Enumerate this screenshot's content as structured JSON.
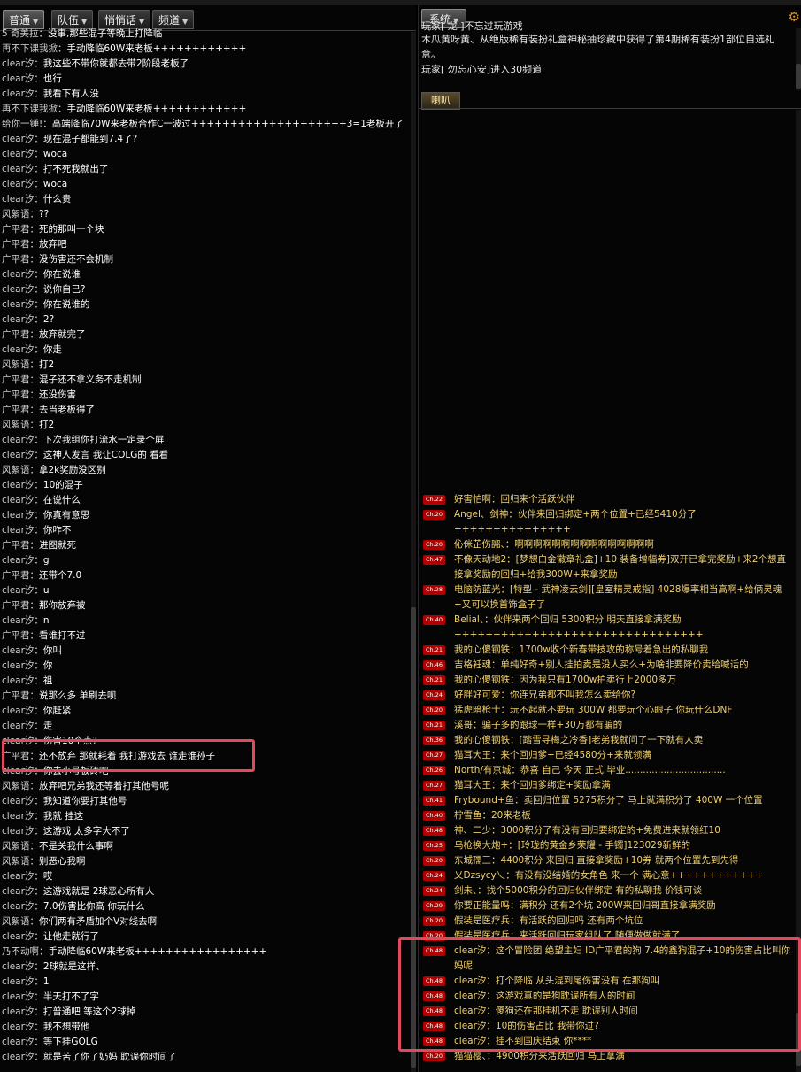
{
  "left_tabs": [
    "普通",
    "队伍",
    "悄悄话",
    "频道"
  ],
  "left_chat": [
    {
      "n": "5  奇美拉",
      "m": "没事,那些混子等晚上打降临"
    },
    {
      "n": "再不下课我掀",
      "m": "手动降临60W来老板++++++++++++"
    },
    {
      "n": "clear汐",
      "m": "我这些不带你就都去带2阶段老板了"
    },
    {
      "n": "clear汐",
      "m": "也行"
    },
    {
      "n": "clear汐",
      "m": "我看下有人没"
    },
    {
      "n": "再不下课我掀",
      "m": "手动降临60W来老板++++++++++++"
    },
    {
      "n": "给你一锤!",
      "m": "高端降临70W来老板合作C一波过++++++++++++++++++++3=1老板开了"
    },
    {
      "n": "clear汐",
      "m": "现在混子都能到7.4了?"
    },
    {
      "n": "clear汐",
      "m": "woca"
    },
    {
      "n": "clear汐",
      "m": "打不死我就出了"
    },
    {
      "n": "clear汐",
      "m": "woca"
    },
    {
      "n": "clear汐",
      "m": "什么贵"
    },
    {
      "n": "风絮语",
      "m": "??"
    },
    {
      "n": "广平君",
      "m": "死的那叫一个块"
    },
    {
      "n": "广平君",
      "m": "放弃吧"
    },
    {
      "n": "广平君",
      "m": "没伤害还不会机制"
    },
    {
      "n": "clear汐",
      "m": "你在说谁"
    },
    {
      "n": "clear汐",
      "m": "说你自己?"
    },
    {
      "n": "clear汐",
      "m": "你在说谁的"
    },
    {
      "n": "clear汐",
      "m": "2?"
    },
    {
      "n": "广平君",
      "m": "放弃就完了"
    },
    {
      "n": "clear汐",
      "m": "你走"
    },
    {
      "n": "风絮语",
      "m": "打2"
    },
    {
      "n": "广平君",
      "m": "混子还不拿义务不走机制"
    },
    {
      "n": "广平君",
      "m": "还没伤害"
    },
    {
      "n": "广平君",
      "m": "去当老板得了"
    },
    {
      "n": "风絮语",
      "m": "打2"
    },
    {
      "n": "clear汐",
      "m": "下次我组你打流水一定录个屏"
    },
    {
      "n": "clear汐",
      "m": "这神人发言 我让COLG的 看看"
    },
    {
      "n": "风絮语",
      "m": "拿2k奖励没区别"
    },
    {
      "n": "clear汐",
      "m": "10的混子"
    },
    {
      "n": "clear汐",
      "m": "在说什么"
    },
    {
      "n": "clear汐",
      "m": "你真有意思"
    },
    {
      "n": "clear汐",
      "m": "你咋不"
    },
    {
      "n": "广平君",
      "m": "进图就死"
    },
    {
      "n": "clear汐",
      "m": "g"
    },
    {
      "n": "广平君",
      "m": "还带个7.0"
    },
    {
      "n": "clear汐",
      "m": "u"
    },
    {
      "n": "广平君",
      "m": "那你放弃被"
    },
    {
      "n": "clear汐",
      "m": "n"
    },
    {
      "n": "广平君",
      "m": "看谁打不过"
    },
    {
      "n": "clear汐",
      "m": "你叫"
    },
    {
      "n": "clear汐",
      "m": "你"
    },
    {
      "n": "clear汐",
      "m": "祖"
    },
    {
      "n": "广平君",
      "m": "说那么多 单刷去呗"
    },
    {
      "n": "clear汐",
      "m": "你赶紧"
    },
    {
      "n": "clear汐",
      "m": "走"
    },
    {
      "n": "clear汐",
      "m": "伤害10个点?"
    },
    {
      "n": "广平君",
      "m": "还不放弃 那就耗着 我打游戏去 谁走谁孙子"
    },
    {
      "n": "clear汐",
      "m": "你去小号板砖吧"
    },
    {
      "n": "风絮语",
      "m": "放弃吧兄弟我还等着打其他号呢"
    },
    {
      "n": "clear汐",
      "m": "我知道你要打其他号"
    },
    {
      "n": "clear汐",
      "m": "我就 挂这"
    },
    {
      "n": "clear汐",
      "m": "这游戏 太多字大不了"
    },
    {
      "n": "风絮语",
      "m": "不是关我什么事啊"
    },
    {
      "n": "风絮语",
      "m": "别恶心我啊"
    },
    {
      "n": "clear汐",
      "m": "哎"
    },
    {
      "n": "clear汐",
      "m": "这游戏就是 2球恶心所有人"
    },
    {
      "n": "clear汐",
      "m": "7.0伤害比你高 你玩什么"
    },
    {
      "n": "风絮语",
      "m": "你们两有矛盾加个V对线去啊"
    },
    {
      "n": "clear汐",
      "m": "让他走就行了"
    },
    {
      "n": "乃不动啊",
      "m": "手动降临60W来老板+++++++++++++++++"
    },
    {
      "n": "clear汐",
      "m": "2球就是这样、"
    },
    {
      "n": "clear汐",
      "m": "1"
    },
    {
      "n": "clear汐",
      "m": "半天打不了字"
    },
    {
      "n": "clear汐",
      "m": "打普通吧 等这个2球掉"
    },
    {
      "n": "clear汐",
      "m": "我不想带他"
    },
    {
      "n": "clear汐",
      "m": "等下挂GOLG"
    },
    {
      "n": "clear汐",
      "m": "就是苦了你了奶妈 耽误你时间了"
    }
  ],
  "right_tab": "系统",
  "system_lines": [
    "玩家[  龙  ]不忘过玩游戏",
    "木瓜黄呀黄、从绝版稀有装扮礼盒神秘抽珍藏中获得了第4期稀有装扮1部位自选礼盒。",
    "玩家[  勿忘心安]进入30频道"
  ],
  "loud_tab": "喇叭",
  "loud": [
    {
      "b": "Ch.22",
      "t": "好害怕啊：回归来个活跃伙伴"
    },
    {
      "b": "Ch.20",
      "t": "Angel、剑神：伙伴来回归绑定+两个位置+已经5410分了+++++++++++++++"
    },
    {
      "b": "Ch.20",
      "t": "伈侎芷伤嘂、：啊啊啊啊啊啊啊啊啊啊啊啊啊啊啊"
    },
    {
      "b": "Ch.47",
      "t": "不像天动地2：[梦想白金徽章礼盒]+10 装备增幅券]双开已拿完奖励+来2个想直接拿奖励的回归+给我300W+来拿奖励"
    },
    {
      "b": "Ch.28",
      "t": "电脑防蓝光：[特型 - 武神凌云剑][皇室精灵戒指] 4028爆率相当高啊+给俩灵魂+又可以换首饰盒子了"
    },
    {
      "b": "Ch.40",
      "t": "Belial、：伙伴来两个回归 5300积分 明天直接拿满奖励++++++++++++++++++++++++++++++++"
    },
    {
      "b": "Ch.21",
      "t": "我的心傻钢铁：1700w收个新春带技攻的称号着急出的私聊我"
    },
    {
      "b": "Ch.46",
      "t": "吉格衽魂：单纯好奇+别人挂拍卖是没人买么+为啥非要降价卖给喊话的"
    },
    {
      "b": "Ch.21",
      "t": "我的心傻钢铁：因为我只有1700w拍卖行上2000多万"
    },
    {
      "b": "Ch.24",
      "t": "好胖好可爱：你连兄弟都不叫我怎么卖给你?"
    },
    {
      "b": "Ch.20",
      "t": "猛虎暗枪士：玩不起就不要玩 300W 都要玩个心眼子 你玩什么DNF"
    },
    {
      "b": "Ch.21",
      "t": "溪哥：骗子多的跟球一样+30万都有骗的"
    },
    {
      "b": "Ch.36",
      "t": "我的心傻钢铁：[踏雪寻梅之冷香]老弟我就问了一下就有人卖"
    },
    {
      "b": "Ch.27",
      "t": "猫耳大王：来个回归爹+已经4580分+来就领满"
    },
    {
      "b": "Ch.26",
      "t": "North/有京城：恭喜 自己 今天 正式 毕业.................................."
    },
    {
      "b": "Ch.27",
      "t": "猫耳大王：来个回归爹绑定+奖励拿满"
    },
    {
      "b": "Ch.41",
      "t": "Frybound+鱼：卖回归位置 5275积分了 马上就满积分了 400W 一个位置"
    },
    {
      "b": "Ch.40",
      "t": "柠雪鱼：20来老板"
    },
    {
      "b": "Ch.48",
      "t": "神、二少：3000积分了有没有回归要绑定的+免费进来就领红10"
    },
    {
      "b": "Ch.25",
      "t": "乌枪换大炮+：[玲珑的黄金乡荣耀 - 手镯]123029新鲜的"
    },
    {
      "b": "Ch.20",
      "t": "东城孺三：4400积分 来回归 直接拿奖励+10券 就两个位置先到先得"
    },
    {
      "b": "Ch.24",
      "t": "乂Dzsycy乀：有没有没结婚的女角色 来一个 满心意++++++++++++"
    },
    {
      "b": "Ch.24",
      "t": "剑未、：找个5000积分的回归伙伴绑定 有的私聊我 价钱可谈"
    },
    {
      "b": "Ch.29",
      "t": "你要正能量吗：满积分 还有2个坑 200W来回归哥直接拿满奖励"
    },
    {
      "b": "Ch.20",
      "t": "假装是医疗兵：有活跃的回归吗 还有两个坑位"
    },
    {
      "b": "Ch.20",
      "t": "假装是医疗兵：来活跃回归玩家组队了 随便做做就满了"
    },
    {
      "b": "Ch.48",
      "t": "clear汐：这个冒险团 绝望主妇 ID广平君的狗 7.4的鑫狗混子+10的伤害占比叫你妈呢"
    },
    {
      "b": "Ch.48",
      "t": "clear汐：打个降临 从头混到尾伤害没有 在那狗叫"
    },
    {
      "b": "Ch.48",
      "t": "clear汐：这游戏真的是狗耽误所有人的时间"
    },
    {
      "b": "Ch.48",
      "t": "clear汐：傻狗还在那挂机不走 耽误别人时间"
    },
    {
      "b": "Ch.48",
      "t": "clear汐：10的伤害占比 我带你过?"
    },
    {
      "b": "Ch.48",
      "t": "clear汐：挂不到国庆结束 你****"
    },
    {
      "b": "Ch.20",
      "t": "猫猫樱、：4900积分来活跃回归 马上拿满"
    }
  ]
}
